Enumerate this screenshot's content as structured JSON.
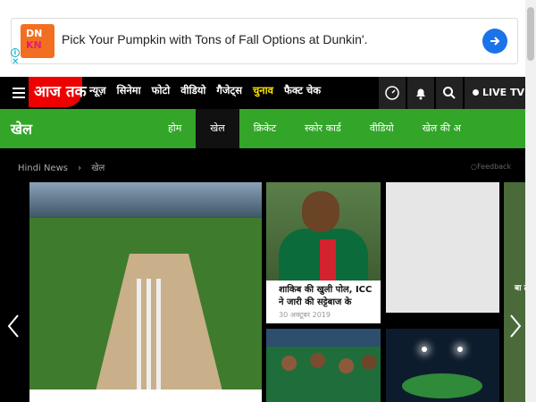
{
  "ad": {
    "logo_top": "DN",
    "logo_bottom": "KN",
    "text": "Pick Your Pumpkin with Tons of Fall Options at Dunkin'.",
    "info_icon": "info-icon",
    "close_icon": "close-icon"
  },
  "nav": {
    "logo": "आज तक",
    "links": [
      "न्यूज़",
      "सिनेमा",
      "फोटो",
      "वीडियो",
      "गैजेट्स",
      "चुनाव",
      "फैक्ट चेक"
    ],
    "live_tv": "LIVE TV",
    "icons": [
      "audio-icon",
      "bell-icon",
      "search-icon"
    ]
  },
  "section": {
    "title": "खेल",
    "tabs": [
      "होम",
      "खेल",
      "क्रिकेट",
      "स्कोर कार्ड",
      "वीडियो",
      "खेल की अ"
    ],
    "active_tab": "खेल"
  },
  "breadcrumb": [
    "Hindi News",
    "खेल"
  ],
  "feedback": "Feedback",
  "stories": {
    "side_headline": "शाकिब की खुली पोल, ICC ने जारी की सट्टेबाज के",
    "side_date": "30 अक्टूबर 2019",
    "peek_text": "बा ते"
  },
  "colors": {
    "brand_red": "#ee0000",
    "section_green": "#33a529",
    "election_yellow": "#ffe400"
  }
}
